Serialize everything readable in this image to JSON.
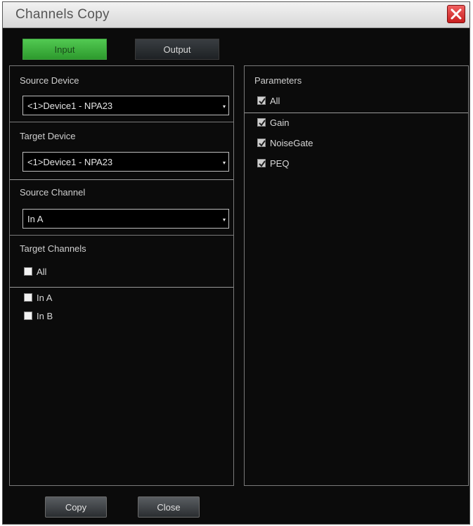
{
  "window": {
    "title": "Channels Copy"
  },
  "tabs": {
    "input": "Input",
    "output": "Output"
  },
  "left": {
    "source_device": {
      "label": "Source Device",
      "value": "<1>Device1 - NPA23"
    },
    "target_device": {
      "label": "Target Device",
      "value": "<1>Device1 - NPA23"
    },
    "source_channel": {
      "label": "Source Channel",
      "value": "In A"
    },
    "target_channels": {
      "label": "Target Channels",
      "all_label": "All",
      "items": [
        {
          "label": "In A",
          "checked": false
        },
        {
          "label": "In B",
          "checked": false
        }
      ]
    }
  },
  "right": {
    "label": "Parameters",
    "all_label": "All",
    "items": [
      {
        "label": "Gain",
        "checked": true
      },
      {
        "label": "NoiseGate",
        "checked": true
      },
      {
        "label": "PEQ",
        "checked": true
      }
    ]
  },
  "buttons": {
    "copy": "Copy",
    "close": "Close"
  },
  "colors": {
    "active_tab": "#3fb53f",
    "close_button": "#d32a2a",
    "background": "#0b0b0b"
  }
}
